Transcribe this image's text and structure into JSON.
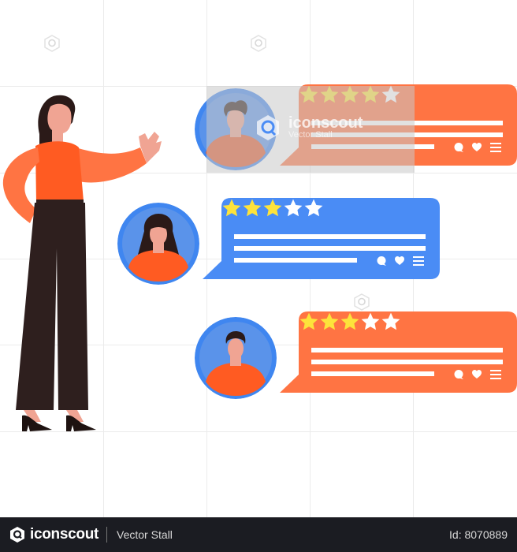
{
  "illustration": {
    "subject": "Customer reviews with star ratings",
    "colors": {
      "orange": "#ff7443",
      "blue": "#4a8cf5",
      "star_filled": "#fde33b",
      "star_empty": "#ffffff",
      "skin": "#f0a493",
      "hair": "#2b1a18",
      "pants": "#2e1f1e",
      "shirt": "#ff5b22"
    },
    "reviews": [
      {
        "bubble_color": "orange",
        "rating": 4,
        "max_rating": 5,
        "avatar": "man-curly-hair"
      },
      {
        "bubble_color": "blue",
        "rating": 3,
        "max_rating": 5,
        "avatar": "woman-long-hair"
      },
      {
        "bubble_color": "orange",
        "rating": 3,
        "max_rating": 5,
        "avatar": "man-short-hair"
      }
    ],
    "review_actions": [
      "comment-icon",
      "heart-icon",
      "menu-icon"
    ]
  },
  "watermark": {
    "brand": "iconscout",
    "author": "Vector Stall"
  },
  "footer": {
    "brand": "iconscout",
    "author": "Vector Stall",
    "asset_id": "Id: 8070889"
  }
}
